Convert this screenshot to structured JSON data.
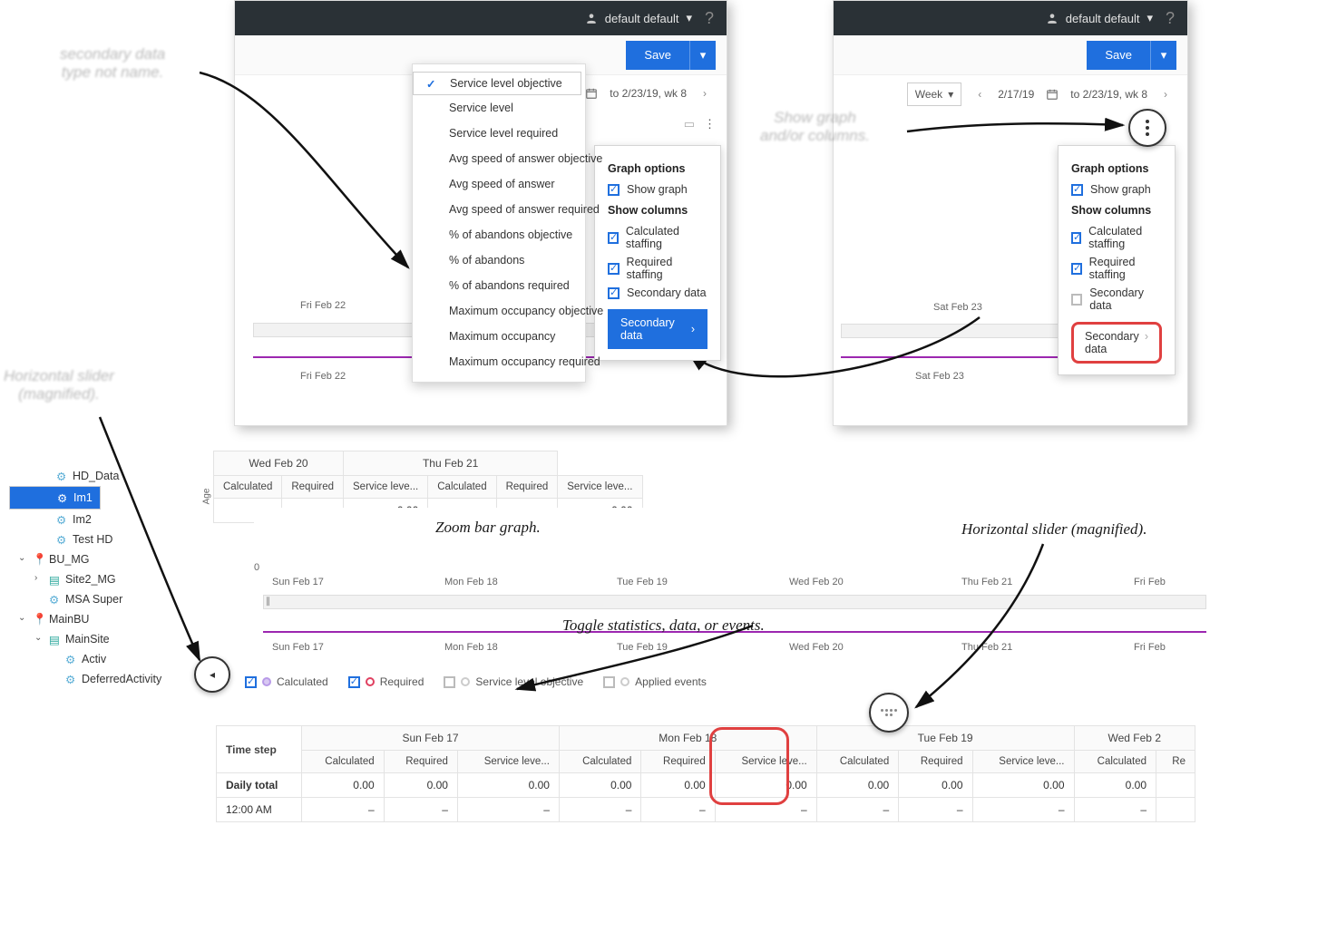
{
  "user": {
    "name": "default default"
  },
  "save_btn": "Save",
  "week_label": "Week",
  "date_from": "2/17/19",
  "date_to_full": "to 2/23/19, wk 8",
  "date_to_trim": "to 2/23/19, wk 8",
  "popover": {
    "graph_options": "Graph options",
    "show_graph": "Show graph",
    "show_columns": "Show columns",
    "calc_staffing": "Calculated staffing",
    "req_staffing": "Required staffing",
    "sec_data": "Secondary data",
    "sec_btn": "Secondary data"
  },
  "menu": {
    "slo": "Service level objective",
    "sl": "Service level",
    "slr": "Service level required",
    "asao": "Avg speed of answer objective",
    "asa": "Avg speed of answer",
    "asar": "Avg speed of answer required",
    "pao": "% of abandons objective",
    "pa": "% of abandons",
    "par": "% of abandons required",
    "moo": "Maximum occupancy objective",
    "mo": "Maximum occupancy",
    "mor": "Maximum occupancy required"
  },
  "days": {
    "sun17": "Sun Feb 17",
    "mon18": "Mon Feb 18",
    "tue19": "Tue Feb 19",
    "wed20": "Wed Feb 20",
    "thu21": "Thu Feb 21",
    "fri22": "Fri Feb 22",
    "sat23": "Sat Feb 23"
  },
  "tree": {
    "hd": "HD_Data",
    "im1": "Im1",
    "im2": "Im2",
    "testhd": "Test HD",
    "bumg": "BU_MG",
    "site2": "Site2_MG",
    "msa": "MSA Super",
    "mainbu": "MainBU",
    "mainsite": "MainSite",
    "activ": "Activ",
    "defact": "DeferredActivity"
  },
  "legend": {
    "calculated": "Calculated",
    "required": "Required",
    "slo": "Service level objective",
    "events": "Applied events"
  },
  "table": {
    "time_step": "Time step",
    "calc": "Calculated",
    "req": "Required",
    "sl": "Service leve...",
    "daily": "Daily total",
    "t0": "12:00 AM",
    "zero": "0.00",
    "dash": "–",
    "val0": "0.00"
  },
  "axis": {
    "zero": "0",
    "age": "Age"
  },
  "annotations": {
    "a1_l1": "secondary data",
    "a1_l2": "type not name.",
    "a2_l1": "Show graph",
    "a2_l2": "and/or columns.",
    "a3_l1": "Horizontal slider",
    "a3_l2": "(magnified).",
    "a4": "Zoom bar graph.",
    "a5": "Horizontal slider (magnified).",
    "a6": "Toggle statistics, data, or events."
  }
}
